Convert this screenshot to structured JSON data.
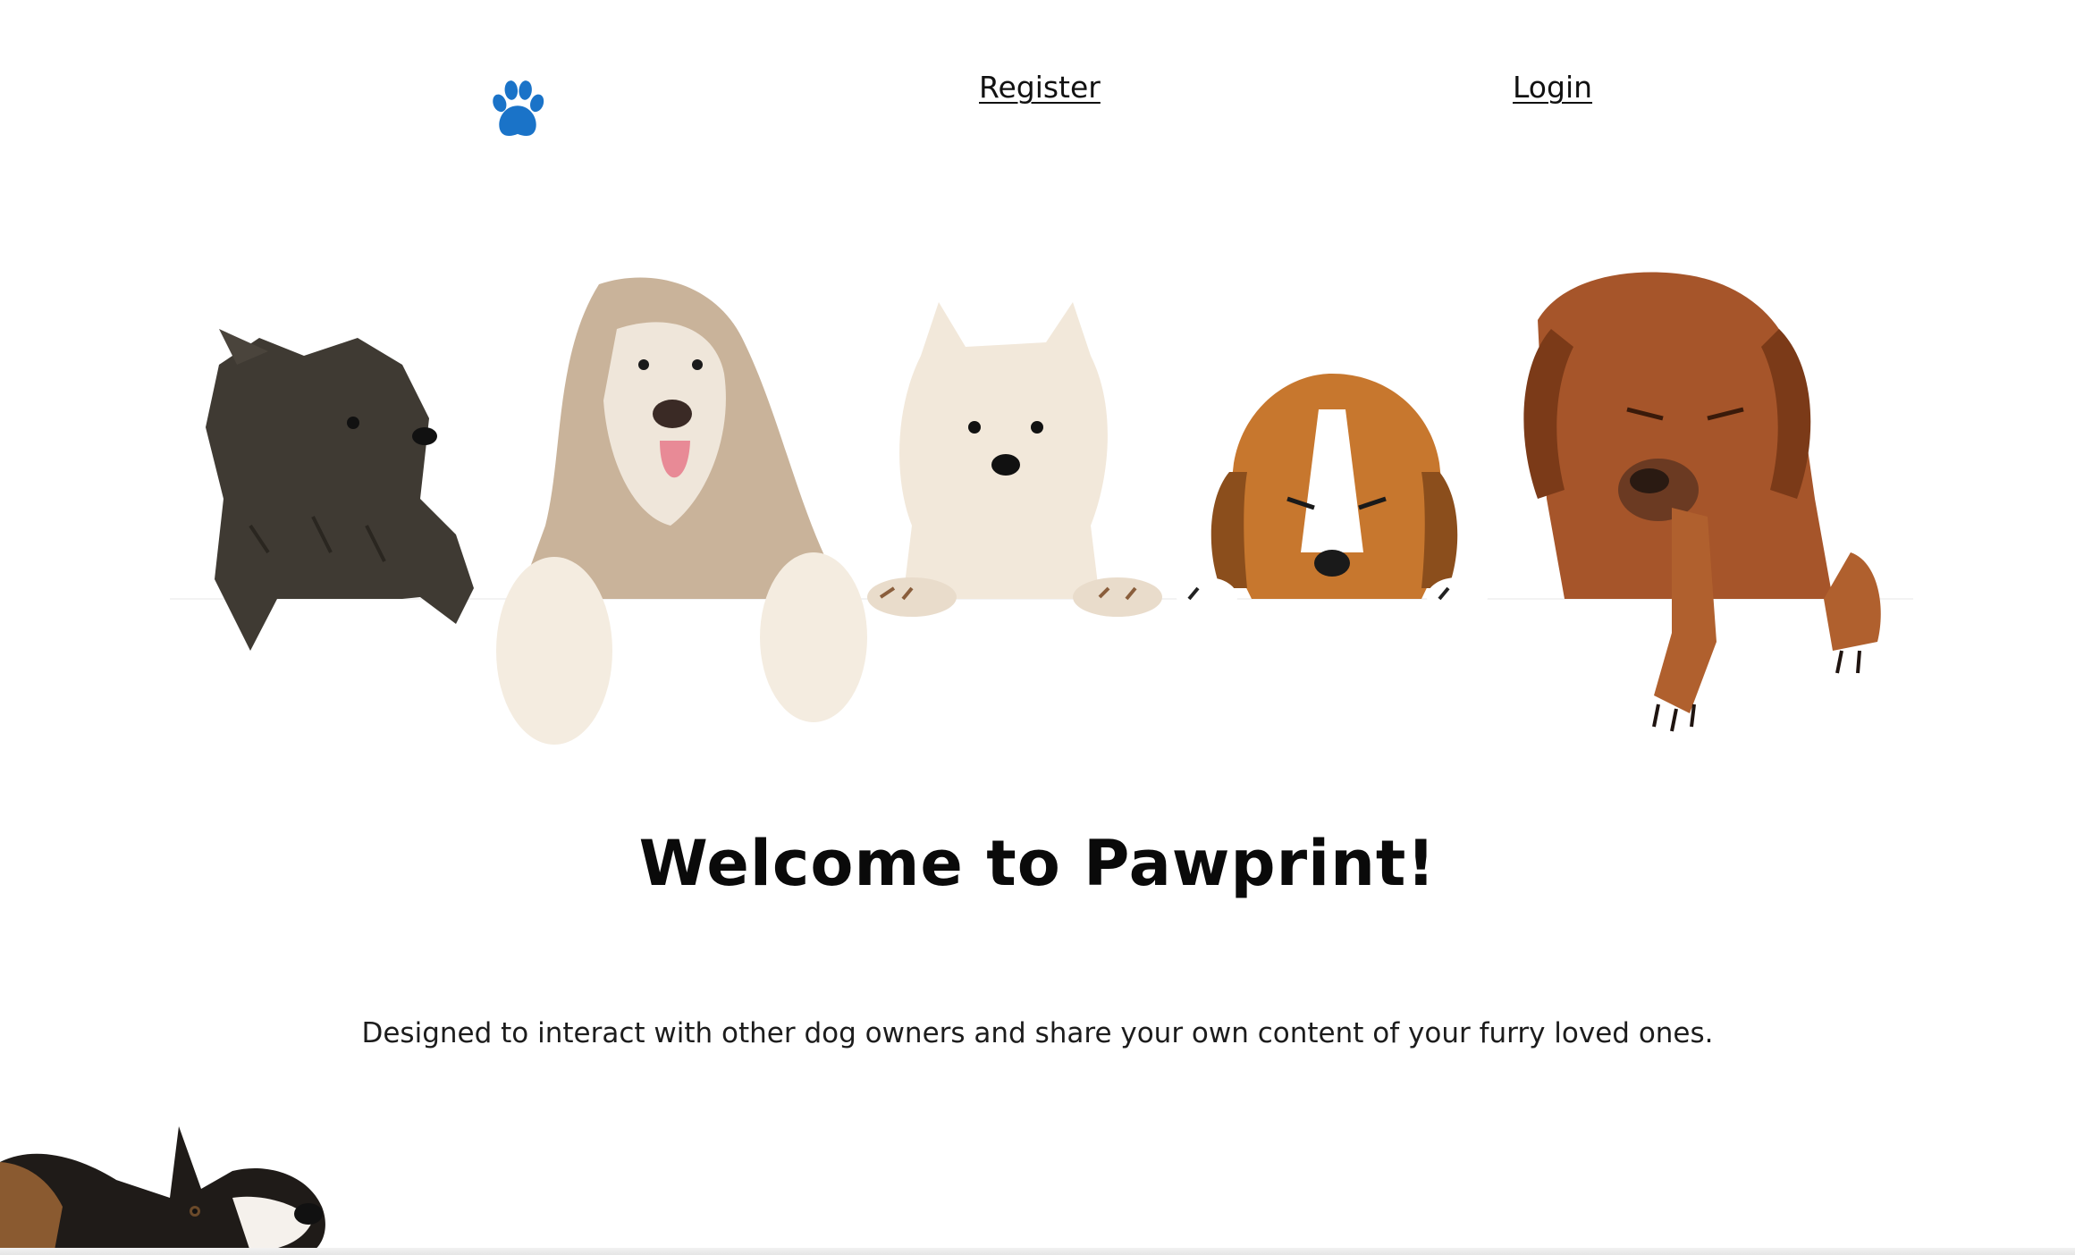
{
  "nav": {
    "logo_icon": "paw-print-icon",
    "register_label": "Register",
    "login_label": "Login",
    "accent_color": "#1a73c8"
  },
  "hero": {
    "image": "five-dogs-peeking-over-white-board"
  },
  "main": {
    "title": "Welcome to Pawprint!",
    "description": "Designed to interact with other dog owners and share your own content of your furry loved ones."
  },
  "decor": {
    "corner_image": "dog-peeking-from-bottom-left"
  }
}
